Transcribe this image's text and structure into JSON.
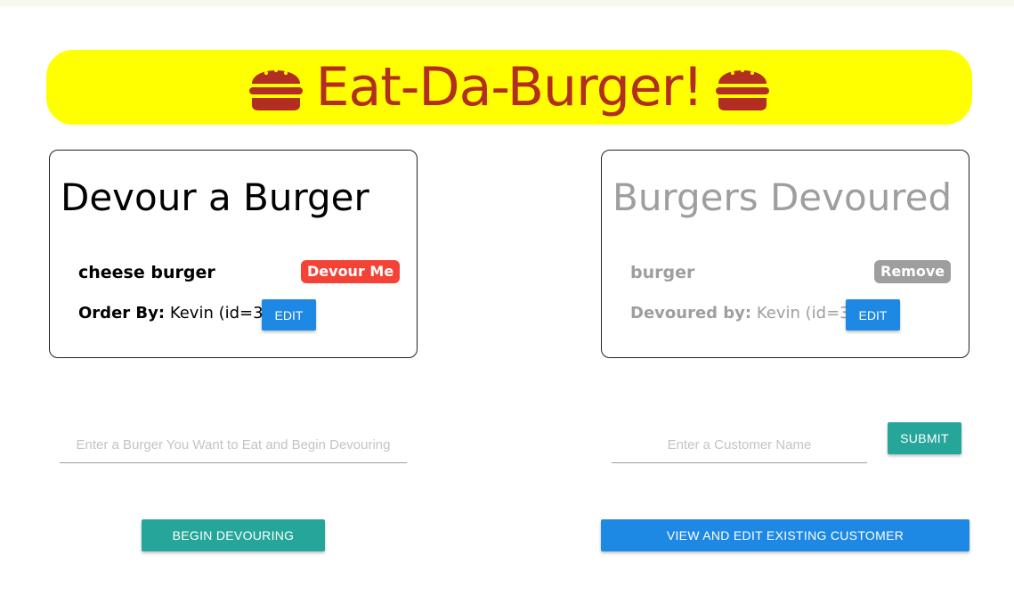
{
  "colors": {
    "banner_bg": "#ffff00",
    "brand_red": "#b22d22",
    "devour_red": "#f44336",
    "remove_gray": "#9e9e9e",
    "edit_blue": "#1e88e5",
    "teal": "#26a69a"
  },
  "banner": {
    "title": "Eat-Da-Burger!",
    "icon_left": "burger-icon",
    "icon_right": "burger-icon"
  },
  "devour_card": {
    "title": "Devour a Burger",
    "burger_name": "cheese burger",
    "action_label": "Devour Me",
    "order_label": "Order By:",
    "customer_text": "Kevin (id=3)",
    "edit_label": "EDIT"
  },
  "devoured_card": {
    "title": "Burgers Devoured",
    "burger_name": "burger",
    "action_label": "Remove",
    "devoured_label": "Devoured by:",
    "customer_text": "Kevin (id=3)",
    "edit_label": "EDIT"
  },
  "burger_form": {
    "placeholder": "Enter a Burger You Want to Eat and Begin Devouring",
    "submit_label": "BEGIN DEVOURING"
  },
  "customer_form": {
    "placeholder": "Enter a Customer Name",
    "submit_label": "SUBMIT",
    "view_label": "VIEW AND EDIT EXISTING CUSTOMER"
  }
}
